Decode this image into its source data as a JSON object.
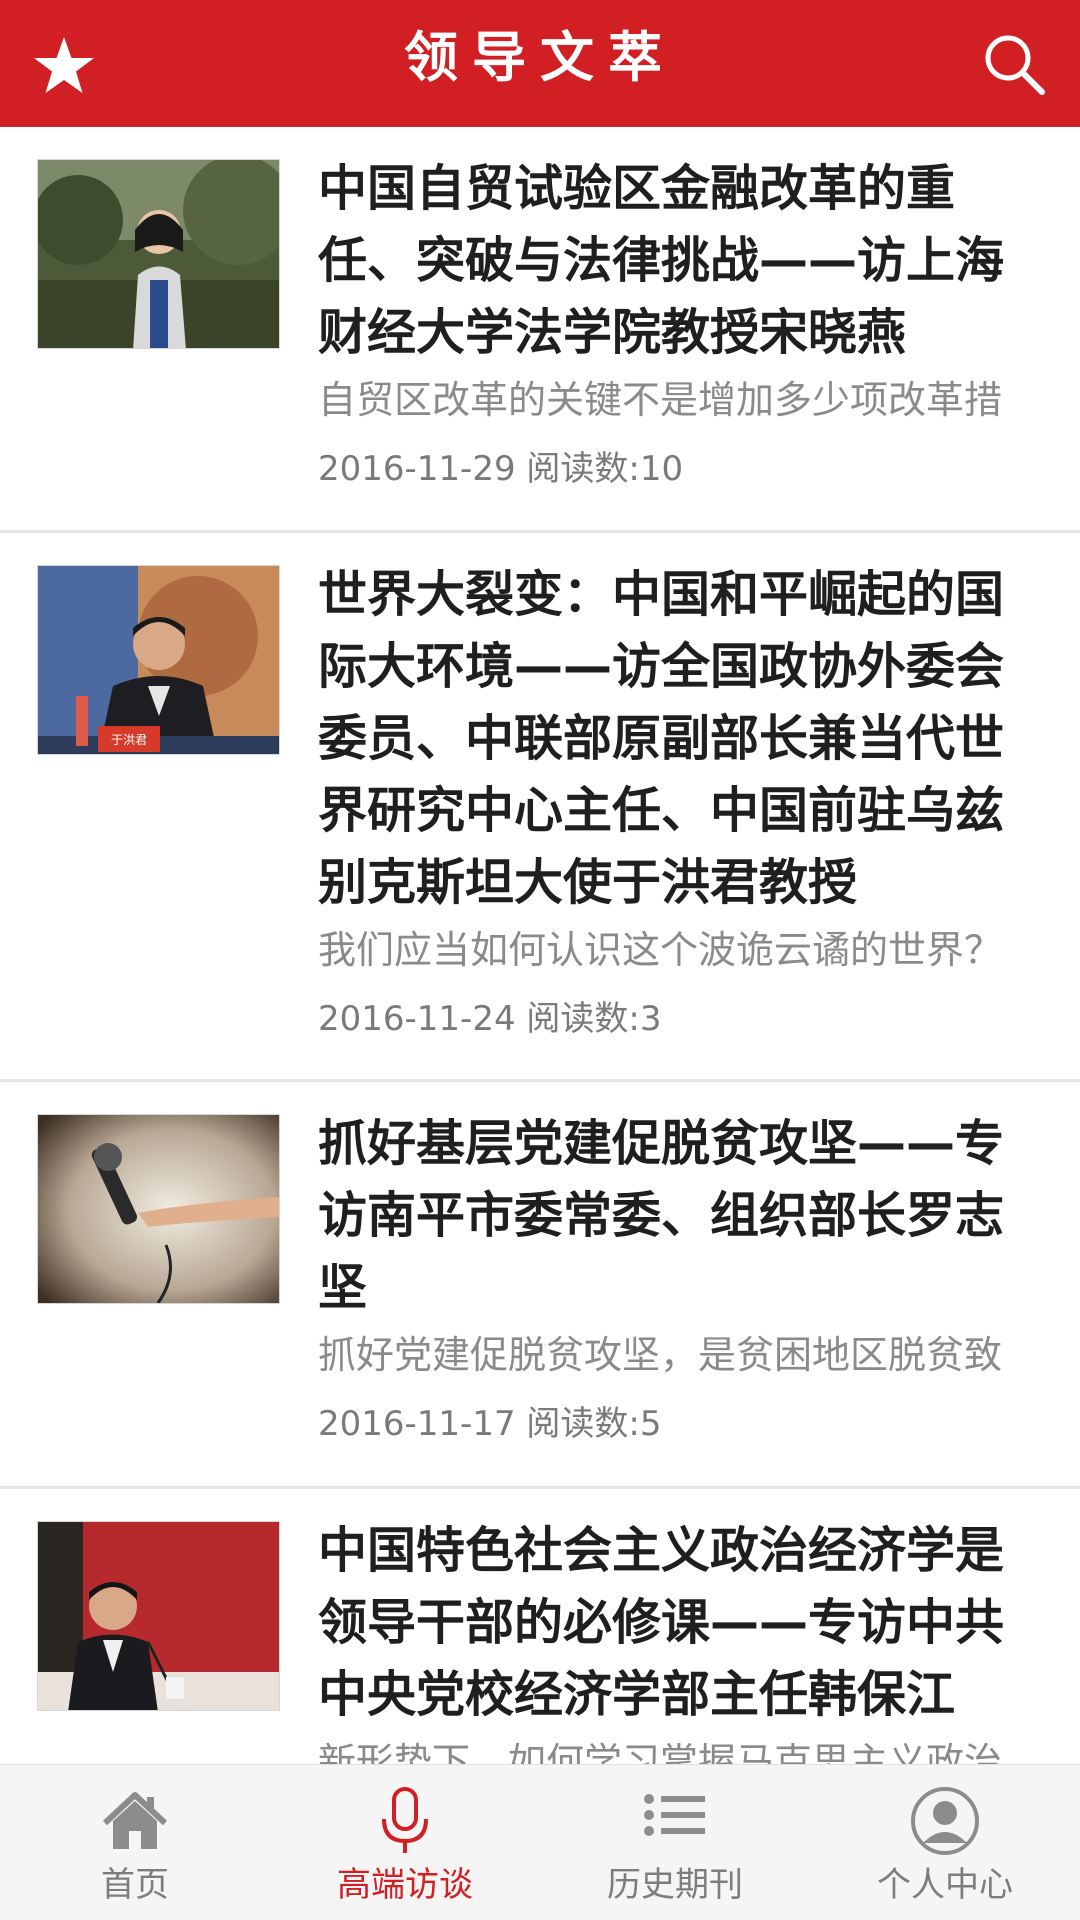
{
  "header": {
    "title": "领导文萃",
    "left_icon": "star-icon",
    "right_icon": "search-icon"
  },
  "colors": {
    "brand": "#d11f24",
    "title_text": "#1f1f1f",
    "summary_text": "#8a8a8a"
  },
  "articles": [
    {
      "title": "中国自贸试验区金融改革的重任、突破与法律挑战——访上海财经大学法学院教授宋晓燕",
      "summary": "自贸区改革的关键不是增加多少项改革措",
      "date": "2016-11-29",
      "reads_label": "阅读数:10",
      "thumb": "portrait-woman-outdoors"
    },
    {
      "title": "世界大裂变：中国和平崛起的国际大环境——访全国政协外委会委员、中联部原副部长兼当代世界研究中心主任、中国前驻乌兹别克斯坦大使于洪君教授",
      "summary": "我们应当如何认识这个波诡云谲的世界？",
      "date": "2016-11-24",
      "reads_label": "阅读数:3",
      "thumb": "speaker-at-podium",
      "nameplate": "于洪君"
    },
    {
      "title": "抓好基层党建促脱贫攻坚——专访南平市委常委、组织部长罗志坚",
      "summary": "抓好党建促脱贫攻坚，是贫困地区脱贫致",
      "date": "2016-11-17",
      "reads_label": "阅读数:5",
      "thumb": "hand-holding-microphone"
    },
    {
      "title": "中国特色社会主义政治经济学是领导干部的必修课——专访中共中央党校经济学部主任韩保江",
      "summary": "新形势下，如何学习掌握马克思主义政治",
      "date": "",
      "reads_label": "",
      "thumb": "man-at-desk-red-backdrop"
    }
  ],
  "tabs": [
    {
      "label": "首页",
      "icon": "home-icon",
      "active": false
    },
    {
      "label": "高端访谈",
      "icon": "microphone-icon",
      "active": true
    },
    {
      "label": "历史期刊",
      "icon": "list-icon",
      "active": false
    },
    {
      "label": "个人中心",
      "icon": "user-icon",
      "active": false
    }
  ]
}
